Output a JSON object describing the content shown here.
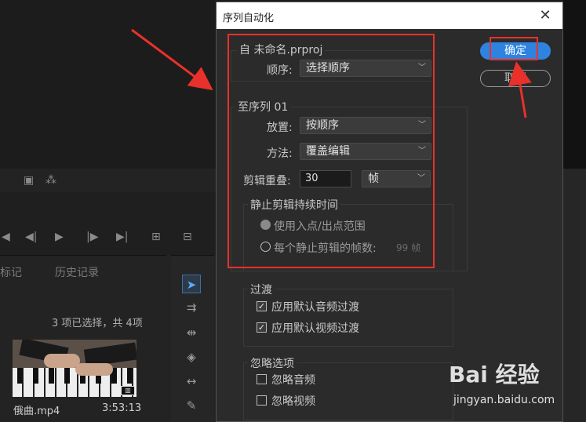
{
  "background": {
    "project_tabs": [
      "标记",
      "历史记录"
    ],
    "selection_status": "3 项已选择，共 4项",
    "clip": {
      "name": "俄曲.mp4",
      "duration": "3:53:13"
    }
  },
  "dialog": {
    "title": "序列自动化",
    "from_label": "自 未命名.prproj",
    "order_label": "顺序:",
    "order_value": "选择顺序",
    "to_label": "至序列 01",
    "placement_label": "放置:",
    "placement_value": "按顺序",
    "method_label": "方法:",
    "method_value": "覆盖编辑",
    "clip_overlap_label": "剪辑重叠:",
    "clip_overlap_value": "30",
    "clip_overlap_unit": "帧",
    "still_duration_label": "静止剪辑持续时间",
    "use_in_out_label": "使用入点/出点范围",
    "frames_per_still_label": "每个静止剪辑的帧数:",
    "frames_per_still_value": "99 帧",
    "transitions_label": "过渡",
    "apply_audio_transition": "应用默认音频过渡",
    "apply_video_transition": "应用默认视频过渡",
    "ignore_options_label": "忽略选项",
    "ignore_audio": "忽略音频",
    "ignore_video": "忽略视频",
    "ok_label": "确定",
    "cancel_label": "取消"
  },
  "watermark": {
    "logo": "Bai 经验",
    "url": "jingyan.baidu.com"
  },
  "colors": {
    "accent": "#2f83e0",
    "annotation": "#e8312a"
  }
}
